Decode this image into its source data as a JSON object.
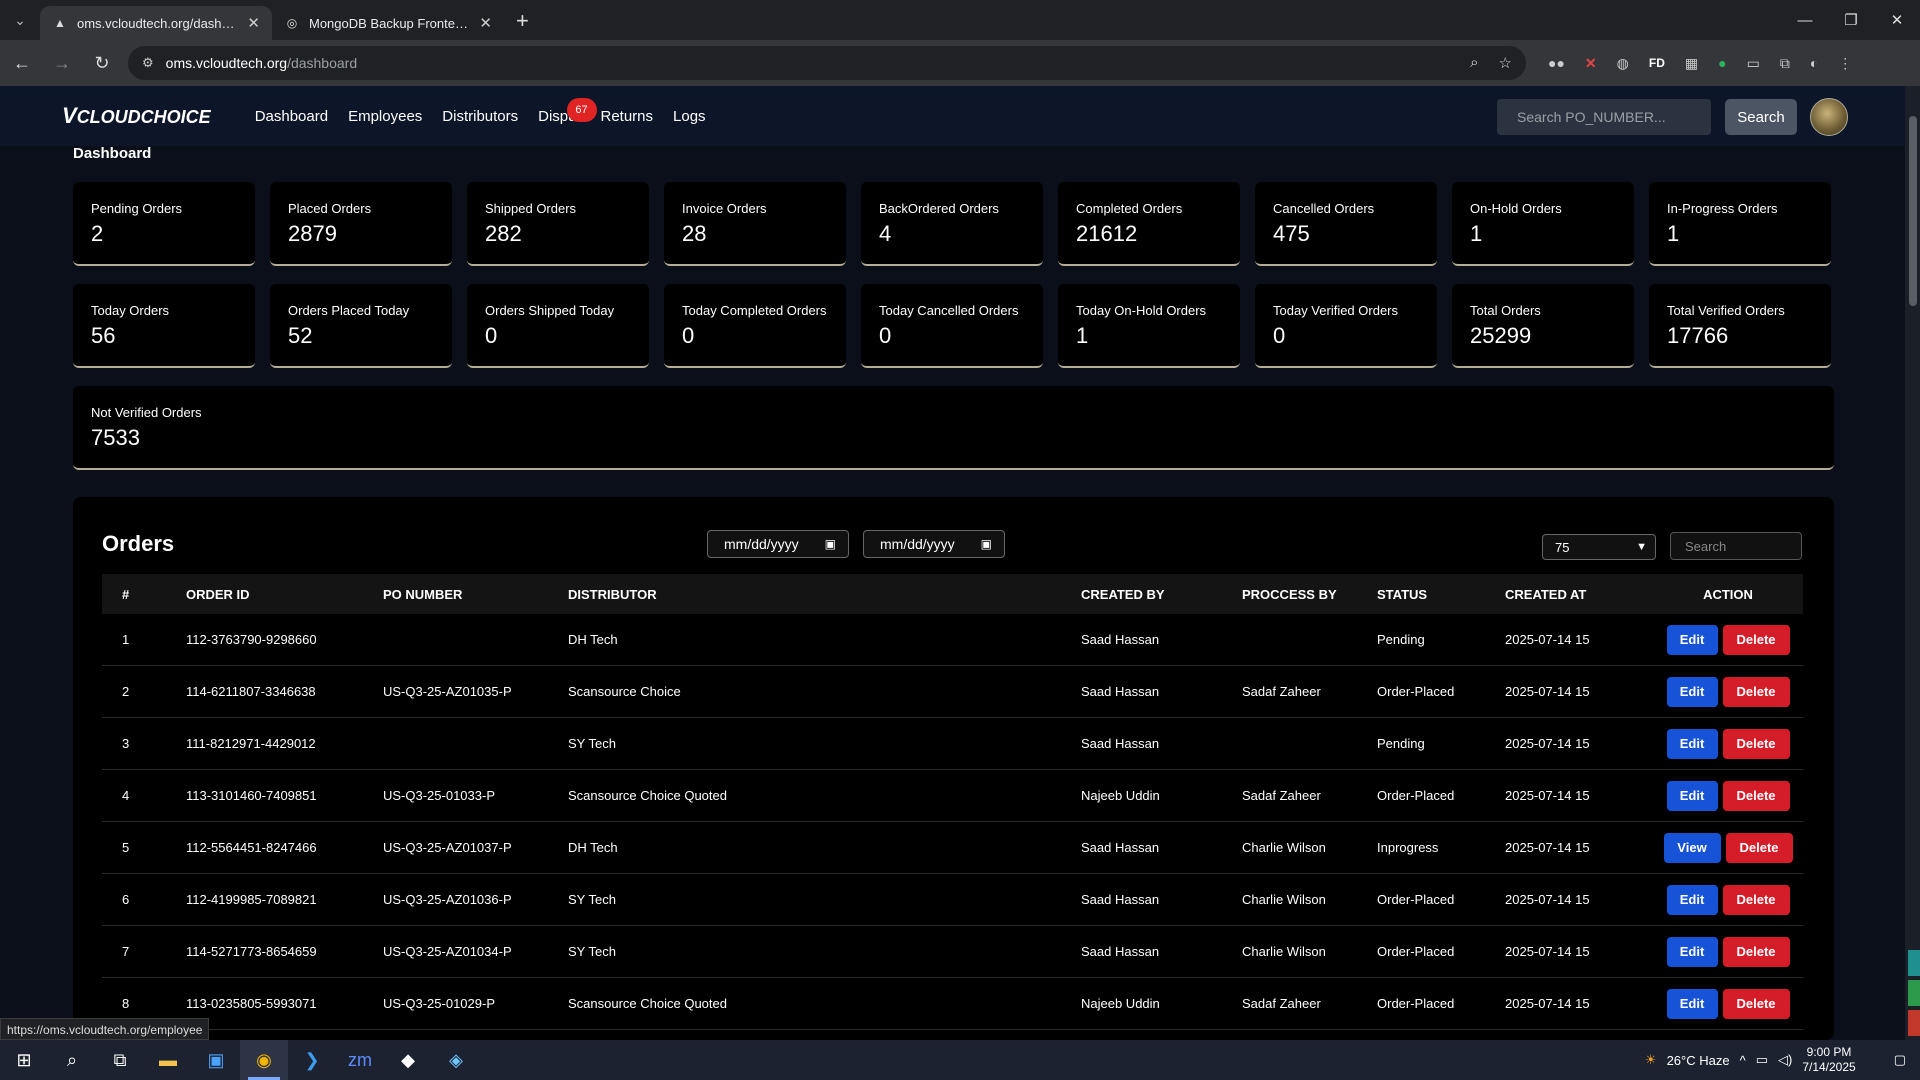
{
  "browser": {
    "tabs": [
      {
        "title": "oms.vcloudtech.org/dashboard",
        "active": true
      },
      {
        "title": "MongoDB Backup Frontend Int",
        "active": false
      }
    ],
    "url_host": "oms.vcloudtech.org",
    "url_path": "/dashboard",
    "status_url": "https://oms.vcloudtech.org/employee"
  },
  "nav": {
    "logo": "CLOUDCHOICE",
    "links": [
      "Dashboard",
      "Employees",
      "Distributors",
      "Dispu",
      "Returns",
      "Logs"
    ],
    "disputes_badge": "67",
    "search_placeholder": "Search PO_NUMBER...",
    "search_button": "Search"
  },
  "page_title": "Dashboard",
  "stats_row1": [
    {
      "label": "Pending Orders",
      "value": "2"
    },
    {
      "label": "Placed Orders",
      "value": "2879"
    },
    {
      "label": "Shipped Orders",
      "value": "282"
    },
    {
      "label": "Invoice Orders",
      "value": "28"
    },
    {
      "label": "BackOrdered Orders",
      "value": "4"
    },
    {
      "label": "Completed Orders",
      "value": "21612"
    },
    {
      "label": "Cancelled Orders",
      "value": "475"
    },
    {
      "label": "On-Hold Orders",
      "value": "1"
    },
    {
      "label": "In-Progress Orders",
      "value": "1"
    }
  ],
  "stats_row2": [
    {
      "label": "Today Orders",
      "value": "56"
    },
    {
      "label": "Orders Placed Today",
      "value": "52"
    },
    {
      "label": "Orders Shipped Today",
      "value": "0"
    },
    {
      "label": "Today Completed Orders",
      "value": "0"
    },
    {
      "label": "Today Cancelled Orders",
      "value": "0"
    },
    {
      "label": "Today On-Hold Orders",
      "value": "1"
    },
    {
      "label": "Today Verified Orders",
      "value": "0"
    },
    {
      "label": "Total Orders",
      "value": "25299"
    },
    {
      "label": "Total Verified Orders",
      "value": "17766"
    }
  ],
  "stat_wide": {
    "label": "Not Verified Orders",
    "value": "7533"
  },
  "orders": {
    "title": "Orders",
    "date_from": "mm/dd/yyyy",
    "date_to": "mm/dd/yyyy",
    "page_size": "75",
    "search_placeholder": "Search",
    "headers": [
      "#",
      "ORDER ID",
      "PO NUMBER",
      "DISTRIBUTOR",
      "CREATED BY",
      "PROCCESS BY",
      "STATUS",
      "CREATED AT",
      "ACTION"
    ],
    "delete_label": "Delete",
    "rows": [
      {
        "n": "1",
        "order_id": "112-3763790-9298660",
        "po": "",
        "distributor": "DH Tech",
        "created_by": "Saad Hassan",
        "process_by": "",
        "status": "Pending",
        "created_at": "2025-07-14 15",
        "action": "Edit"
      },
      {
        "n": "2",
        "order_id": "114-6211807-3346638",
        "po": "US-Q3-25-AZ01035-P",
        "distributor": "Scansource Choice",
        "created_by": "Saad Hassan",
        "process_by": "Sadaf Zaheer",
        "status": "Order-Placed",
        "created_at": "2025-07-14 15",
        "action": "Edit"
      },
      {
        "n": "3",
        "order_id": "111-8212971-4429012",
        "po": "",
        "distributor": "SY Tech",
        "created_by": "Saad Hassan",
        "process_by": "",
        "status": "Pending",
        "created_at": "2025-07-14 15",
        "action": "Edit"
      },
      {
        "n": "4",
        "order_id": "113-3101460-7409851",
        "po": "US-Q3-25-01033-P",
        "distributor": "Scansource Choice Quoted",
        "created_by": "Najeeb Uddin",
        "process_by": "Sadaf Zaheer",
        "status": "Order-Placed",
        "created_at": "2025-07-14 15",
        "action": "Edit"
      },
      {
        "n": "5",
        "order_id": "112-5564451-8247466",
        "po": "US-Q3-25-AZ01037-P",
        "distributor": "DH Tech",
        "created_by": "Saad Hassan",
        "process_by": "Charlie Wilson",
        "status": "Inprogress",
        "created_at": "2025-07-14 15",
        "action": "View"
      },
      {
        "n": "6",
        "order_id": "112-4199985-7089821",
        "po": "US-Q3-25-AZ01036-P",
        "distributor": "SY Tech",
        "created_by": "Saad Hassan",
        "process_by": "Charlie Wilson",
        "status": "Order-Placed",
        "created_at": "2025-07-14 15",
        "action": "Edit"
      },
      {
        "n": "7",
        "order_id": "114-5271773-8654659",
        "po": "US-Q3-25-AZ01034-P",
        "distributor": "SY Tech",
        "created_by": "Saad Hassan",
        "process_by": "Charlie Wilson",
        "status": "Order-Placed",
        "created_at": "2025-07-14 15",
        "action": "Edit"
      },
      {
        "n": "8",
        "order_id": "113-0235805-5993071",
        "po": "US-Q3-25-01029-P",
        "distributor": "Scansource Choice Quoted",
        "created_by": "Najeeb Uddin",
        "process_by": "Sadaf Zaheer",
        "status": "Order-Placed",
        "created_at": "2025-07-14 15",
        "action": "Edit"
      }
    ]
  },
  "taskbar": {
    "weather": "26°C  Haze",
    "time": "9:00 PM",
    "date": "7/14/2025"
  }
}
